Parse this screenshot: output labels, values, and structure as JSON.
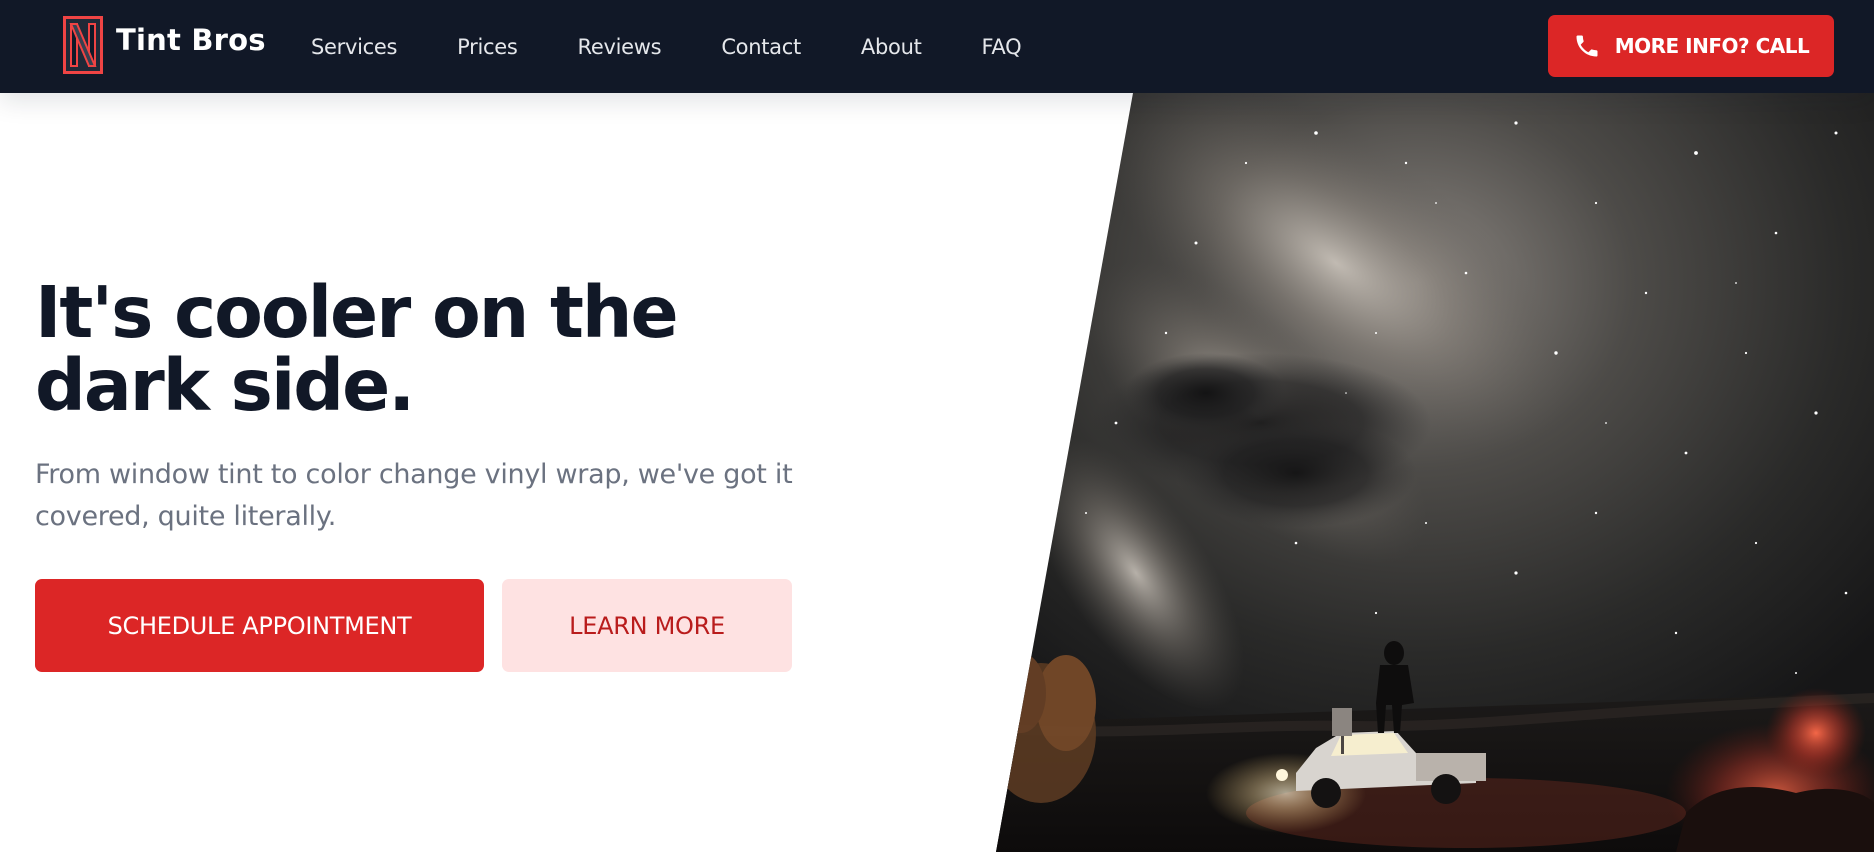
{
  "header": {
    "brand_name": "Tint Bros",
    "logo_icon": "tint-bros-logo-icon",
    "nav": [
      {
        "label": "Services"
      },
      {
        "label": "Prices"
      },
      {
        "label": "Reviews"
      },
      {
        "label": "Contact"
      },
      {
        "label": "About"
      },
      {
        "label": "FAQ"
      }
    ],
    "call_button": {
      "label": "MORE INFO? CALL",
      "icon": "phone-icon"
    }
  },
  "hero": {
    "title": "It's cooler on the dark side.",
    "subtitle": "From window tint to color change vinyl wrap, we've got it covered, quite literally.",
    "primary_button": "SCHEDULE APPOINTMENT",
    "secondary_button": "LEARN MORE",
    "image": "night-sky-milky-way-truck-photo"
  },
  "colors": {
    "nav_background": "#111827",
    "accent": "#dc2626",
    "secondary_button_bg": "#fee2e2",
    "secondary_button_text": "#b91c1c",
    "title_text": "#111827",
    "subtitle_text": "#6b7280"
  }
}
